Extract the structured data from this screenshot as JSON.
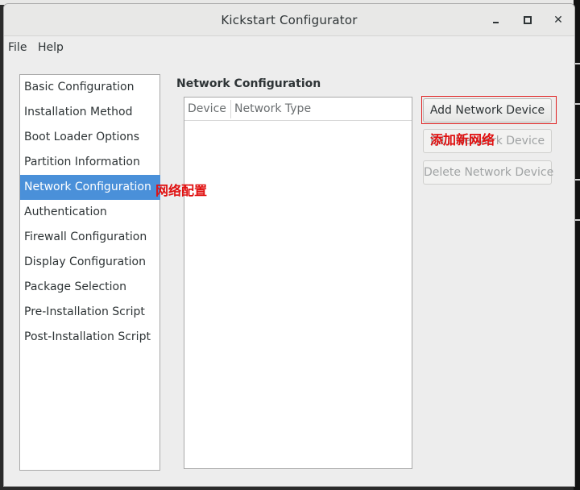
{
  "window": {
    "title": "Kickstart Configurator"
  },
  "menu": {
    "items": [
      "File",
      "Help"
    ]
  },
  "sidebar": {
    "items": [
      {
        "label": "Basic Configuration",
        "selected": false
      },
      {
        "label": "Installation Method",
        "selected": false
      },
      {
        "label": "Boot Loader Options",
        "selected": false
      },
      {
        "label": "Partition Information",
        "selected": false
      },
      {
        "label": "Network Configuration",
        "selected": true
      },
      {
        "label": "Authentication",
        "selected": false
      },
      {
        "label": "Firewall Configuration",
        "selected": false
      },
      {
        "label": "Display Configuration",
        "selected": false
      },
      {
        "label": "Package Selection",
        "selected": false
      },
      {
        "label": "Pre-Installation Script",
        "selected": false
      },
      {
        "label": "Post-Installation Script",
        "selected": false
      }
    ]
  },
  "main": {
    "section_title": "Network Configuration",
    "table": {
      "columns": [
        "Device",
        "Network Type"
      ],
      "rows": []
    },
    "buttons": {
      "add": "Add Network Device",
      "edit": "Edit Network Device",
      "delete": "Delete Network Device"
    }
  },
  "annotations": {
    "network_config": "网络配置",
    "add_network": "添加新网络"
  },
  "colors": {
    "selection": "#4a90d9",
    "annotation": "#e01010"
  }
}
